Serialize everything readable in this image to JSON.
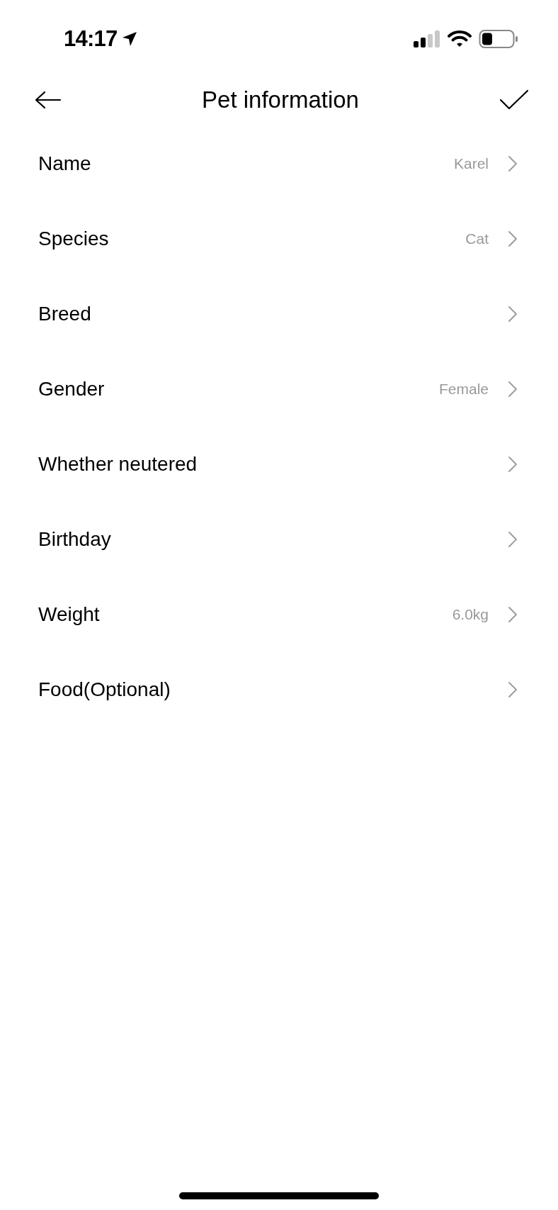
{
  "status_bar": {
    "time": "14:17"
  },
  "header": {
    "title": "Pet information"
  },
  "fields": [
    {
      "label": "Name",
      "value": "Karel"
    },
    {
      "label": "Species",
      "value": "Cat"
    },
    {
      "label": "Breed"
    },
    {
      "label": "Gender",
      "value": "Female"
    },
    {
      "label": "Whether neutered"
    },
    {
      "label": "Birthday"
    },
    {
      "label": "Weight",
      "value": "6.0kg"
    },
    {
      "label": "Food(Optional)"
    }
  ]
}
